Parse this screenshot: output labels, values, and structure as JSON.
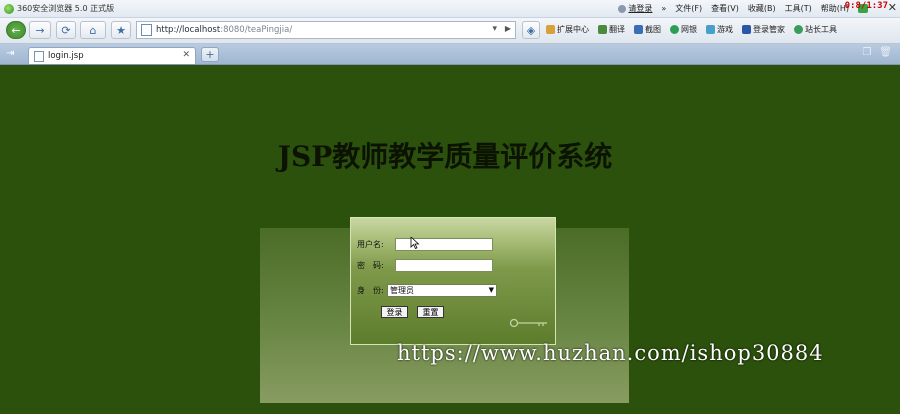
{
  "window": {
    "title": "360安全浏览器 5.0 正式版",
    "clock": "0:8/1:37"
  },
  "menu": {
    "login": "请登录",
    "chevron": "»",
    "items": [
      "文件(F)",
      "查看(V)",
      "收藏(B)",
      "工具(T)",
      "帮助(H)"
    ]
  },
  "address": {
    "url_host": "http://localhost",
    "url_rest": ":8080/teaPingjia/"
  },
  "toolbar": {
    "items": [
      "扩展中心",
      "翻译",
      "截图",
      "网银",
      "游戏",
      "登录管家",
      "站长工具"
    ]
  },
  "tabs": [
    {
      "label": "login.jsp"
    }
  ],
  "page": {
    "system_title": "JSP教师教学质量评价系统",
    "form": {
      "username_label": "用户名:",
      "password_label": "密　码:",
      "role_label": "身　份:",
      "role_selected": "管理员",
      "login_button": "登录",
      "reset_button": "重置"
    }
  },
  "watermark": "https://www.huzhan.com/ishop30884",
  "colors": {
    "page_background": "#2b510c",
    "login_panel": "#8ba35a"
  }
}
